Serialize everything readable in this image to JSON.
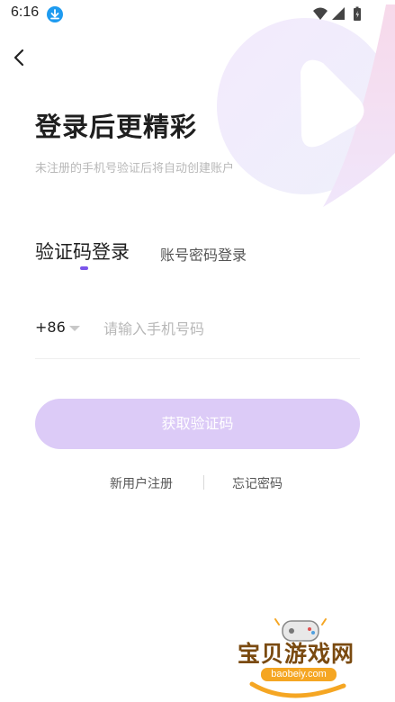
{
  "status_bar": {
    "time": "6:16",
    "icons": [
      "download-icon",
      "wifi-icon",
      "signal-icon",
      "battery-icon"
    ]
  },
  "header": {
    "back_icon": "chevron-left-icon"
  },
  "main": {
    "title": "登录后更精彩",
    "subtitle": "未注册的手机号验证后将自动创建账户",
    "tabs": [
      {
        "label": "验证码登录",
        "active": true
      },
      {
        "label": "账号密码登录",
        "active": false
      }
    ],
    "phone": {
      "country_code": "+86",
      "placeholder": "请输入手机号码",
      "value": ""
    },
    "submit_label": "获取验证码",
    "links": {
      "register": "新用户注册",
      "forgot": "忘记密码"
    }
  },
  "watermark": {
    "text": "宝贝游戏网",
    "url": "baobeiy.com"
  },
  "colors": {
    "accent": "#7b55ea",
    "button_disabled_bg": "#dccbf7",
    "status_download": "#1e9bf0",
    "watermark_brown": "#7a4a10",
    "watermark_orange": "#f5a623"
  }
}
